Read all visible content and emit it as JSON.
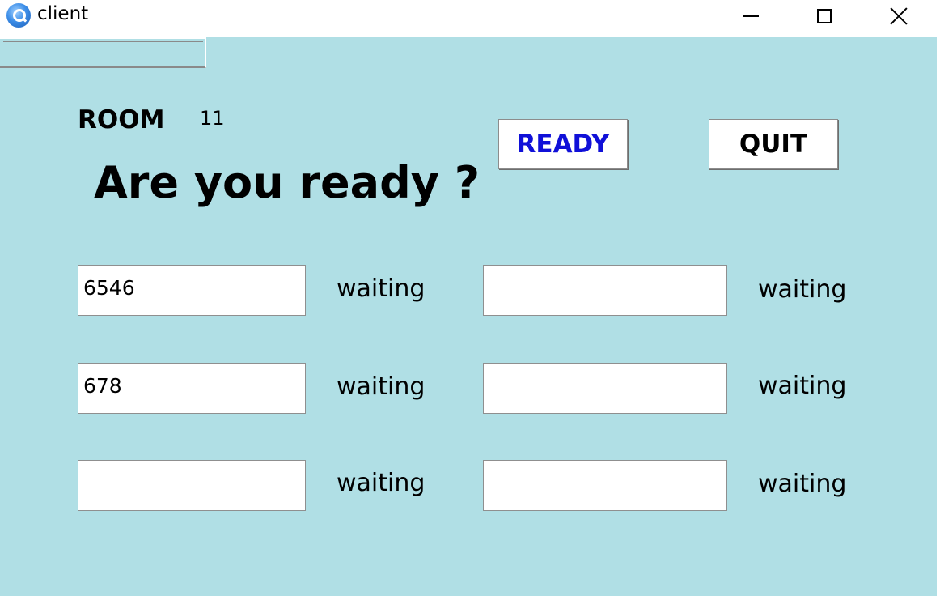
{
  "window": {
    "title": "client",
    "icon": "search-icon",
    "controls": [
      "minimize-icon",
      "maximize-icon",
      "close-icon"
    ]
  },
  "room": {
    "label": "ROOM",
    "number": "11"
  },
  "headline": "Are you ready ?",
  "buttons": {
    "ready": "READY",
    "quit": "QUIT"
  },
  "players": [
    {
      "name": "6546",
      "status": "waiting"
    },
    {
      "name": "678",
      "status": "waiting"
    },
    {
      "name": "",
      "status": "waiting"
    },
    {
      "name": "",
      "status": "waiting"
    },
    {
      "name": "",
      "status": "waiting"
    },
    {
      "name": "",
      "status": "waiting"
    }
  ],
  "colors": {
    "background": "#b0dfe5",
    "ready_text": "#1010d8",
    "quit_text": "#000000"
  }
}
